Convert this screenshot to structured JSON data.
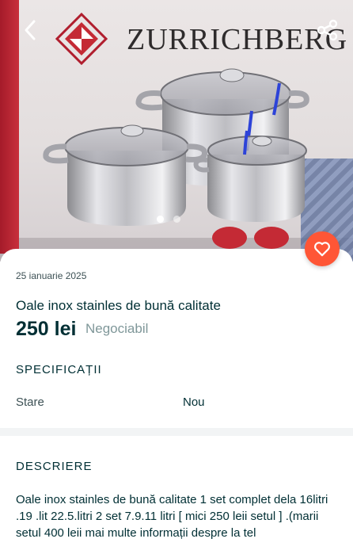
{
  "hero": {
    "brand": "ZURRICHBERG",
    "carousel": {
      "count": 2,
      "active_index": 0
    }
  },
  "actions": {
    "back_icon": "chevron-left-icon",
    "share_icon": "share-icon",
    "favorite_icon": "heart-icon"
  },
  "listing": {
    "date": "25 ianuarie 2025",
    "title": "Oale inox stainles de bună calitate",
    "price": "250 lei",
    "negotiable": "Negociabil"
  },
  "specs": {
    "heading": "SPECIFICAȚII",
    "rows": [
      {
        "label": "Stare",
        "value": "Nou"
      }
    ]
  },
  "description": {
    "heading": "DESCRIERE",
    "text": "Oale inox stainles de bună calitate 1 set complet dela 16litri .19 .lit 22.5.litri 2 set 7.9.11 litri [ mici 250 leii setul ] .(marii setul 400 leii mai multe informații despre la tel"
  },
  "colors": {
    "accent": "#ff5636",
    "text": "#002f34",
    "muted": "#7f9799",
    "band": "#f2f4f5"
  }
}
